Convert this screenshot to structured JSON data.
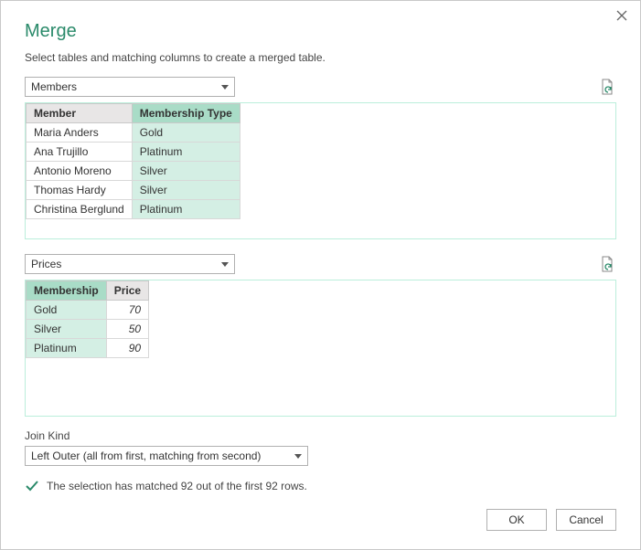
{
  "title": "Merge",
  "subtitle": "Select tables and matching columns to create a merged table.",
  "table1": {
    "name": "Members",
    "columns": [
      "Member",
      "Membership Type"
    ],
    "selectedCol": 1,
    "rows": [
      [
        "Maria Anders",
        "Gold"
      ],
      [
        "Ana Trujillo",
        "Platinum"
      ],
      [
        "Antonio Moreno",
        "Silver"
      ],
      [
        "Thomas Hardy",
        "Silver"
      ],
      [
        "Christina Berglund",
        "Platinum"
      ]
    ]
  },
  "table2": {
    "name": "Prices",
    "columns": [
      "Membership",
      "Price"
    ],
    "selectedCol": 0,
    "numericCol": 1,
    "rows": [
      [
        "Gold",
        "70"
      ],
      [
        "Silver",
        "50"
      ],
      [
        "Platinum",
        "90"
      ]
    ]
  },
  "joinKind": {
    "label": "Join Kind",
    "value": "Left Outer (all from first, matching from second)"
  },
  "status": "The selection has matched 92 out of the first 92 rows.",
  "buttons": {
    "ok": "OK",
    "cancel": "Cancel"
  }
}
